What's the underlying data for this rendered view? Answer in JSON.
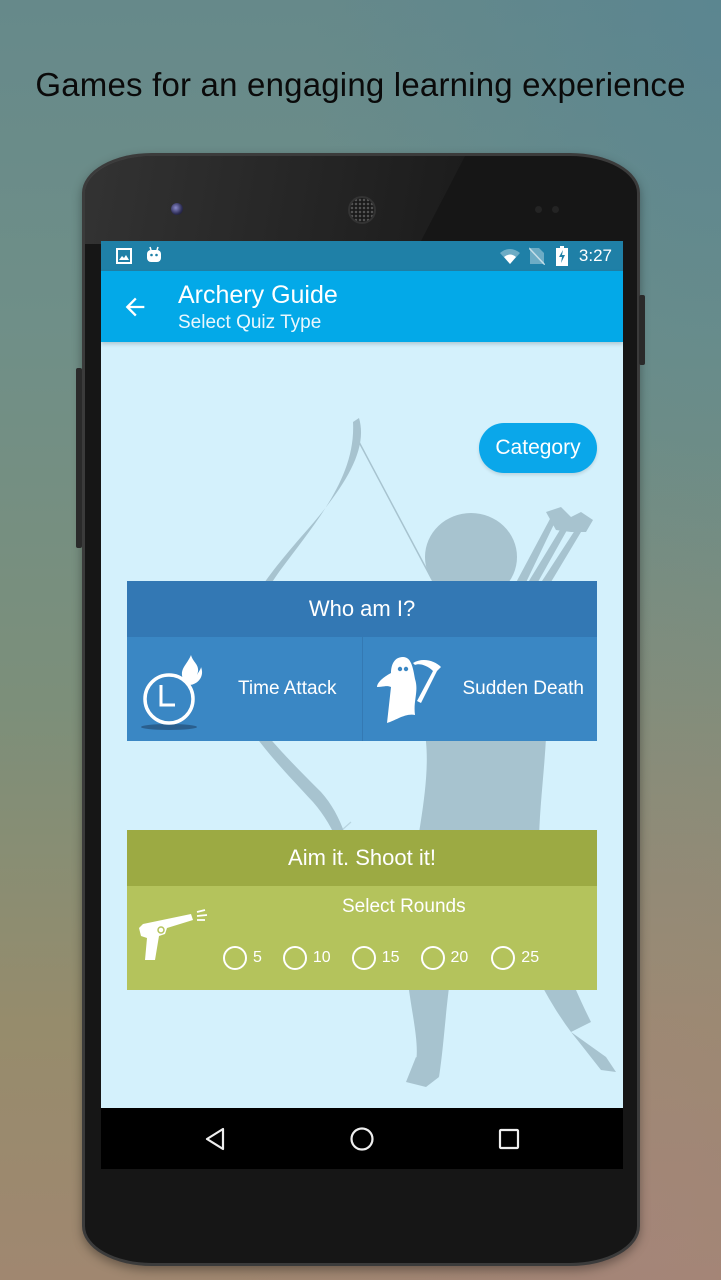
{
  "headline": "Games for an engaging learning experience",
  "status_bar": {
    "time": "3:27",
    "icons": [
      "image-notification-icon",
      "android-notification-icon",
      "wifi-icon",
      "no-sim-icon",
      "battery-charging-icon"
    ]
  },
  "app_bar": {
    "title": "Archery Guide",
    "subtitle": "Select Quiz Type",
    "back_icon": "arrow-left-icon"
  },
  "category_button": "Category",
  "quiz_card": {
    "title": "Who am I?",
    "modes": [
      {
        "label": "Time Attack",
        "icon": "flaming-clock-icon"
      },
      {
        "label": "Sudden Death",
        "icon": "ghost-reaper-icon"
      }
    ],
    "color_header": "#3378b4",
    "color_body": "#3a87c4"
  },
  "shoot_card": {
    "title": "Aim it. Shoot it!",
    "rounds_label": "Select Rounds",
    "icon": "pistol-icon",
    "rounds": [
      {
        "label": "5",
        "selected": false
      },
      {
        "label": "10",
        "selected": false
      },
      {
        "label": "15",
        "selected": false
      },
      {
        "label": "20",
        "selected": false
      },
      {
        "label": "25",
        "selected": false
      }
    ],
    "color_header": "#9caa43",
    "color_body": "#b4c35c"
  },
  "nav_bar": {
    "buttons": [
      "back-triangle-icon",
      "home-circle-icon",
      "recents-square-icon"
    ]
  },
  "colors": {
    "app_bar": "#03a9e8",
    "status_bar": "#1f80a7",
    "screen_background": "#d4f1fc",
    "category_button": "#0aa7ea"
  }
}
